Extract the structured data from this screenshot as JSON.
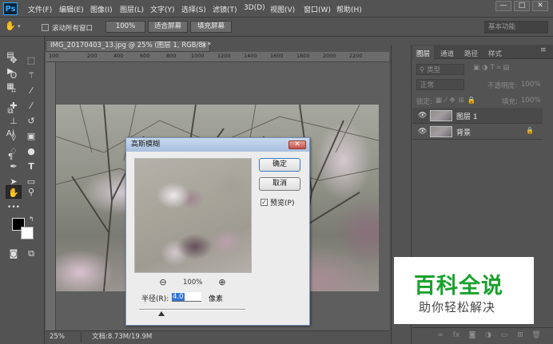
{
  "app": {
    "logo": "Ps"
  },
  "menu": [
    "文件(F)",
    "编辑(E)",
    "图像(I)",
    "图层(L)",
    "文字(Y)",
    "选择(S)",
    "滤镜(T)",
    "3D(D)",
    "视图(V)",
    "窗口(W)",
    "帮助(H)"
  ],
  "window_controls": {
    "minimize": "—",
    "restore": "□",
    "close": "✕"
  },
  "options_bar": {
    "scroll_all_windows": "滚动所有窗口",
    "zoom_100": "100%",
    "fit_screen": "适合屏幕",
    "fill_screen": "填充屏幕",
    "workspace": "基本功能"
  },
  "document": {
    "tab_title": "IMG_20170403_13.jpg @ 25% (图层 1, RGB/8) *",
    "tab_close": "×",
    "ruler_ticks": [
      "100",
      "200",
      "400",
      "600",
      "800",
      "1000",
      "1200",
      "1400",
      "1600",
      "1800",
      "2000",
      "2200"
    ],
    "zoom": "25%",
    "doc_info": "文档:8.73M/19.9M"
  },
  "tools": [
    "move-icon",
    "marquee-icon",
    "lasso-icon",
    "magic-wand-icon",
    "crop-icon",
    "eyedropper-icon",
    "healing-brush-icon",
    "brush-icon",
    "clone-stamp-icon",
    "history-brush-icon",
    "eraser-icon",
    "gradient-icon",
    "blur-icon",
    "dodge-icon",
    "pen-icon",
    "type-icon",
    "path-select-icon",
    "shape-icon",
    "hand-icon",
    "zoom-icon"
  ],
  "dialog": {
    "title": "高斯模糊",
    "close": "✕",
    "ok": "确定",
    "cancel": "取消",
    "preview_label": "预览(P)",
    "preview_checked": true,
    "zoom_out": "⊖",
    "zoom_in": "⊕",
    "zoom_percent": "100%",
    "radius_label": "半径(R):",
    "radius_value": "4.0",
    "radius_unit": "像素"
  },
  "panel": {
    "tabs": [
      "图层",
      "通道",
      "路径",
      "样式"
    ],
    "filter_kind": "类型",
    "blend_mode": "正常",
    "opacity_label": "不透明度:",
    "opacity_value": "100%",
    "lock_label": "锁定:",
    "fill_label": "填充:",
    "fill_value": "100%",
    "layers": [
      {
        "name": "图层 1",
        "selected": true
      },
      {
        "name": "背景",
        "selected": false,
        "locked": true
      }
    ],
    "footer_icons": [
      "link-icon",
      "fx-icon",
      "mask-icon",
      "adjustment-icon",
      "group-icon",
      "new-layer-icon",
      "trash-icon"
    ]
  },
  "watermark": {
    "title": "百科全说",
    "subtitle": "助你轻松解决"
  }
}
